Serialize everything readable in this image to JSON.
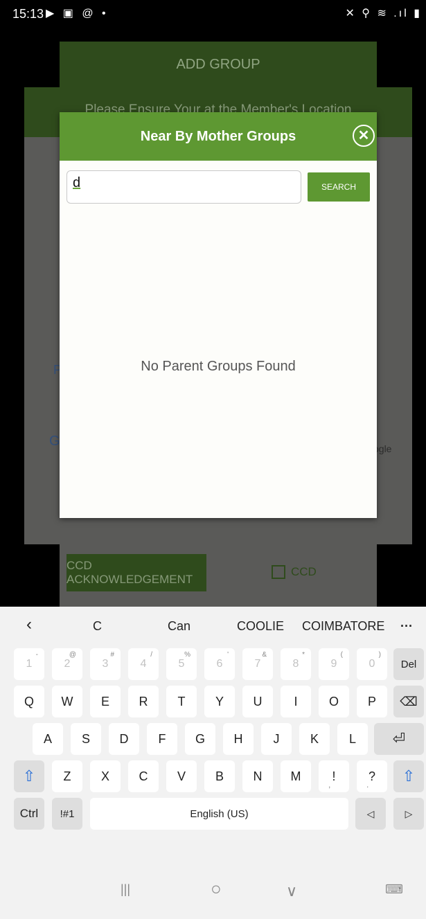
{
  "status_bar": {
    "time": "15:13",
    "left_icons": "▶ ▣ @ •",
    "right_icons": "✕ ⚲ ≋ .ıl ▮"
  },
  "background": {
    "add_group_title": "ADD GROUP",
    "location_notice": "Please Ensure Your at the Member's Location",
    "map_letter_p": "P",
    "map_letter_g": "G",
    "map_google_fragment": "ogle",
    "ccd_ack_button": "CCD ACKNOWLEDGEMENT",
    "ccd_checkbox_label": "CCD"
  },
  "modal": {
    "title": "Near By Mother Groups",
    "close_glyph": "✕",
    "search_value": "d",
    "search_button": "SEARCH",
    "empty_message": "No Parent Groups Found"
  },
  "keyboard": {
    "suggestions": [
      "‹",
      "C",
      "Can",
      "COOLIE",
      "COIMBATORE",
      "···"
    ],
    "number_row": [
      {
        "main": "1",
        "sup": "-"
      },
      {
        "main": "2",
        "sup": "@"
      },
      {
        "main": "3",
        "sup": "#"
      },
      {
        "main": "4",
        "sup": "/"
      },
      {
        "main": "5",
        "sup": "%"
      },
      {
        "main": "6",
        "sup": "'"
      },
      {
        "main": "7",
        "sup": "&"
      },
      {
        "main": "8",
        "sup": "*"
      },
      {
        "main": "9",
        "sup": "("
      },
      {
        "main": "0",
        "sup": ")"
      }
    ],
    "del_key": "Del",
    "row_q": [
      "Q",
      "W",
      "E",
      "R",
      "T",
      "Y",
      "U",
      "I",
      "O",
      "P"
    ],
    "backspace_glyph": "⌫",
    "row_a": [
      "A",
      "S",
      "D",
      "F",
      "G",
      "H",
      "J",
      "K",
      "L"
    ],
    "enter_glyph": "⏎",
    "shift_glyph": "⇧",
    "row_z": [
      "Z",
      "X",
      "C",
      "V",
      "B",
      "N",
      "M"
    ],
    "punct_1": "!",
    "punct_1_sub": ",",
    "punct_2": "?",
    "punct_2_sub": ".",
    "ctrl_key": "Ctrl",
    "sym_key": "!#1",
    "space_label": "English (US)",
    "left_arrow": "◁",
    "right_arrow": "▷"
  },
  "nav_bar": {
    "recents": "|||",
    "home": "○",
    "back": "∨",
    "keyboard_toggle": "⌨"
  },
  "colors": {
    "accent_green": "#5e9832",
    "dim_green": "#2f4b1c"
  }
}
